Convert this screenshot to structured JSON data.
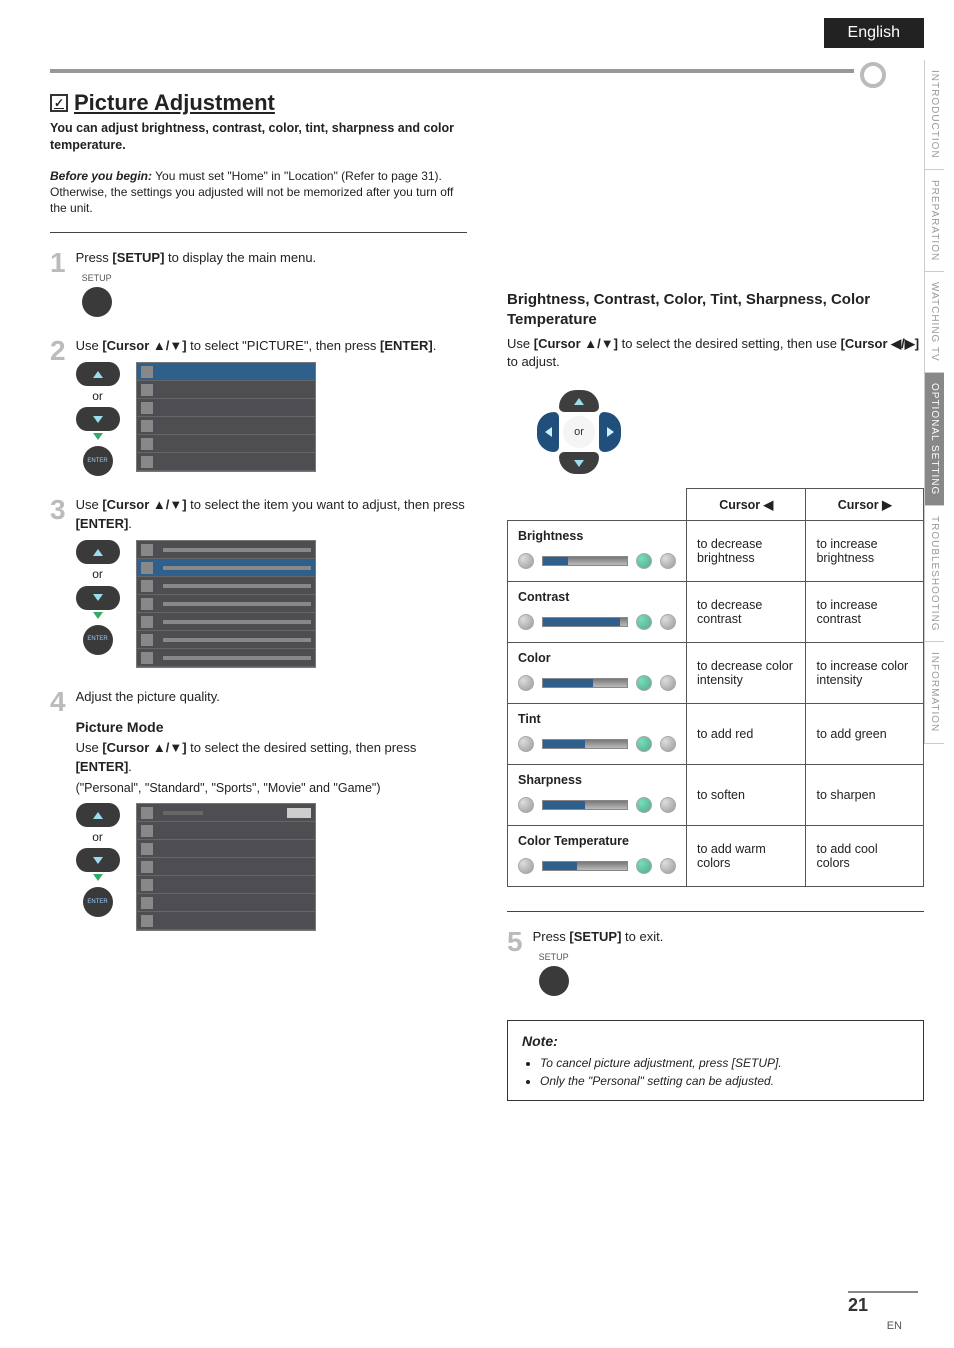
{
  "language_tab": "English",
  "side_tabs": [
    "INTRODUCTION",
    "PREPARATION",
    "WATCHING  TV",
    "OPTIONAL  SETTING",
    "TROUBLESHOOTING",
    "INFORMATION"
  ],
  "side_tab_active_index": 3,
  "title": "Picture Adjustment",
  "intro": "You can adjust brightness, contrast, color, tint, sharpness and color temperature.",
  "before": {
    "label": "Before you begin:",
    "text": "You must set \"Home\" in \"Location\" (Refer to page 31). Otherwise, the settings you adjusted will not be memorized after you turn off the unit."
  },
  "steps": {
    "s1": {
      "num": "1",
      "pre": "Press ",
      "kw": "[SETUP]",
      "post": " to display the main menu.",
      "setup_label": "SETUP"
    },
    "s2": {
      "num": "2",
      "pre": "Use ",
      "kw": "[Cursor ▲/▼]",
      "mid": " to select \"PICTURE\", then press ",
      "kw2": "[ENTER]",
      "post": ".",
      "or": "or",
      "enter_label": "ENTER"
    },
    "s3": {
      "num": "3",
      "pre": "Use ",
      "kw": "[Cursor ▲/▼]",
      "mid": " to select the item you want to adjust, then press ",
      "kw2": "[ENTER]",
      "post": ".",
      "or": "or",
      "enter_label": "ENTER"
    },
    "s4": {
      "num": "4",
      "text": "Adjust the picture quality.",
      "picture_mode_heading": "Picture Mode",
      "pm_pre": "Use ",
      "pm_kw": "[Cursor ▲/▼]",
      "pm_mid": " to select the desired setting, then press ",
      "pm_kw2": "[ENTER]",
      "pm_post": ".",
      "pm_paren": "(\"Personal\", \"Standard\", \"Sports\", \"Movie\" and \"Game\")",
      "or": "or",
      "enter_label": "ENTER"
    },
    "s5": {
      "num": "5",
      "pre": "Press ",
      "kw": "[SETUP]",
      "post": " to exit.",
      "setup_label": "SETUP"
    }
  },
  "right": {
    "heading": "Brightness, Contrast, Color, Tint, Sharpness, Color Temperature",
    "desc_pre": "Use ",
    "desc_kw1": "[Cursor ▲/▼]",
    "desc_mid": " to select the desired setting, then use ",
    "desc_kw2": "[Cursor ◀/▶]",
    "desc_post": " to adjust.",
    "or": "or"
  },
  "table": {
    "h_left": "Cursor ◀",
    "h_right": "Cursor ▶",
    "rows": [
      {
        "name": "Brightness",
        "left": "to decrease brightness",
        "right": "to increase brightness",
        "fill": 30
      },
      {
        "name": "Contrast",
        "left": "to decrease contrast",
        "right": "to increase contrast",
        "fill": 92
      },
      {
        "name": "Color",
        "left": "to decrease color intensity",
        "right": "to increase color intensity",
        "fill": 60
      },
      {
        "name": "Tint",
        "left": "to add red",
        "right": "to add green",
        "fill": 50
      },
      {
        "name": "Sharpness",
        "left": "to soften",
        "right": "to sharpen",
        "fill": 50
      },
      {
        "name": "Color Temperature",
        "left": "to add warm colors",
        "right": "to add cool colors",
        "fill": 40
      }
    ]
  },
  "note": {
    "title": "Note:",
    "items": [
      "To cancel picture adjustment, press [SETUP].",
      "Only the \"Personal\" setting can be adjusted."
    ]
  },
  "page_number": "21",
  "footer_en": "EN"
}
